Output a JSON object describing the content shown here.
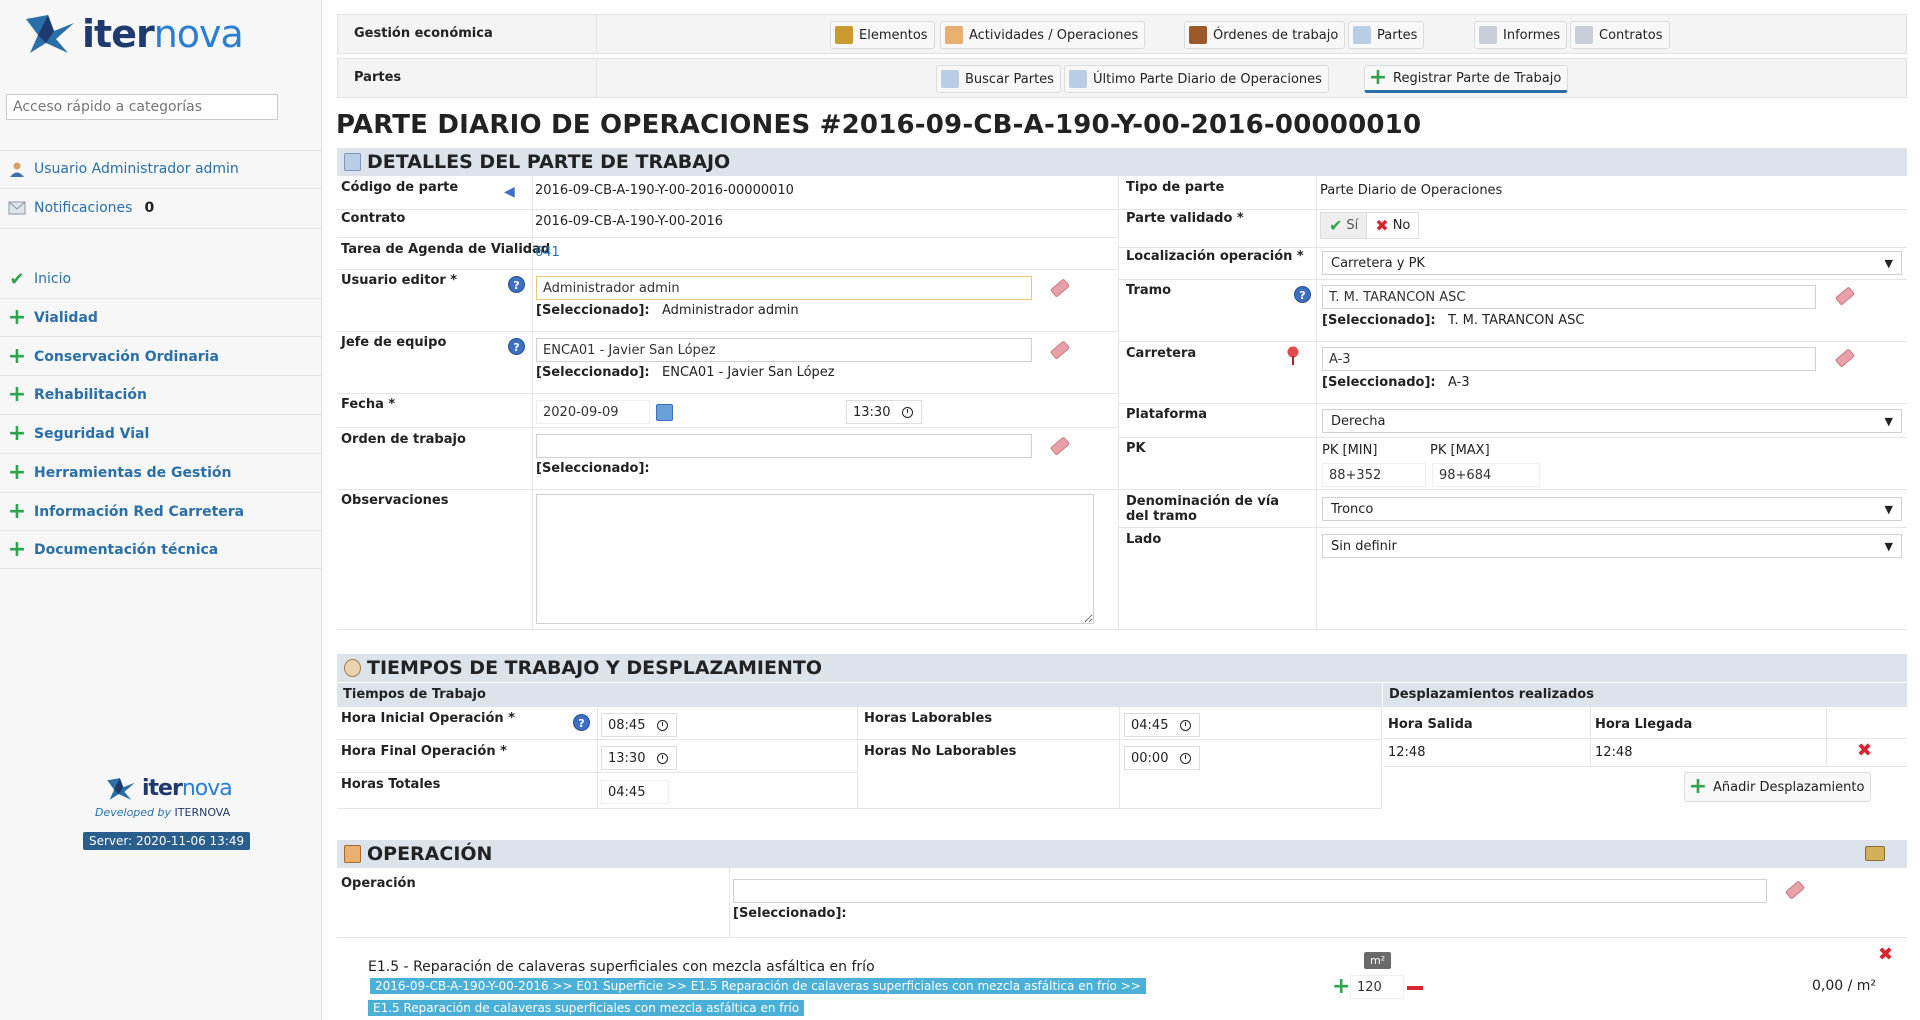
{
  "sidebar": {
    "logo_text_a": "iter",
    "logo_text_b": "nova",
    "search_placeholder": "Acceso rápido a categorías",
    "user": "Usuario Administrador admin",
    "notifications_label": "Notificaciones",
    "notifications_count": "0",
    "menu": [
      "Inicio",
      "Vialidad",
      "Conservación Ordinaria",
      "Rehabilitación",
      "Seguridad Vial",
      "Herramientas de Gestión",
      "Información Red Carretera",
      "Documentación técnica"
    ],
    "developed_by": "Developed by",
    "developer": "ITERNOVA",
    "server": "Server: 2020-11-06 13:49"
  },
  "nav": {
    "row1_label": "Gestión económica",
    "row2_label": "Partes",
    "row1_buttons": [
      "Elementos",
      "Actividades / Operaciones",
      "Órdenes de trabajo",
      "Partes",
      "Informes",
      "Contratos"
    ],
    "row2_buttons": [
      "Buscar Partes",
      "Último Parte Diario de Operaciones",
      "Registrar Parte de Trabajo"
    ]
  },
  "page_title": "PARTE DIARIO DE OPERACIONES #2016-09-CB-A-190-Y-00-2016-00000010",
  "details": {
    "heading": "DETALLES DEL PARTE DE TRABAJO",
    "codigo_label": "Código de parte",
    "codigo_value": "2016-09-CB-A-190-Y-00-2016-00000010",
    "contrato_label": "Contrato",
    "contrato_value": "2016-09-CB-A-190-Y-00-2016",
    "tarea_label": "Tarea de Agenda de Vialidad",
    "tarea_value": "641",
    "usuario_label": "Usuario editor *",
    "usuario_value": "Administrador admin",
    "usuario_selected": "Administrador admin",
    "jefe_label": "Jefe de equipo",
    "jefe_value": "ENCA01 - Javier San López",
    "jefe_selected": "ENCA01 - Javier San López",
    "fecha_label": "Fecha *",
    "fecha_value": "2020-09-09",
    "hora_value": "13:30",
    "orden_label": "Orden de trabajo",
    "orden_value": "",
    "observ_label": "Observaciones",
    "observ_value": "",
    "selected_prefix": "[Seleccionado]:",
    "tipo_label": "Tipo de parte",
    "tipo_value": "Parte Diario de Operaciones",
    "validado_label": "Parte validado *",
    "validado_yes": "Sí",
    "validado_no": "No",
    "localizacion_label": "Localización operación *",
    "localizacion_value": "Carretera y PK",
    "tramo_label": "Tramo",
    "tramo_value": "T. M. TARANCON ASC",
    "tramo_selected": "T. M. TARANCON ASC",
    "carretera_label": "Carretera",
    "carretera_value": "A-3",
    "carretera_selected": "A-3",
    "plataforma_label": "Plataforma",
    "plataforma_value": "Derecha",
    "pk_label": "PK",
    "pk_min_label": "PK [MIN]",
    "pk_max_label": "PK [MAX]",
    "pk_min_value": "88+352",
    "pk_max_value": "98+684",
    "denominacion_label": "Denominación de vía del tramo",
    "denominacion_value": "Tronco",
    "lado_label": "Lado",
    "lado_value": "Sin definir"
  },
  "tiempos": {
    "heading": "TIEMPOS DE TRABAJO Y DESPLAZAMIENTO",
    "sub_left": "Tiempos de Trabajo",
    "sub_right": "Desplazamientos realizados",
    "hora_inicial_label": "Hora Inicial Operación *",
    "hora_inicial_value": "08:45",
    "hora_final_label": "Hora Final Operación *",
    "hora_final_value": "13:30",
    "horas_totales_label": "Horas Totales",
    "horas_totales_value": "04:45",
    "horas_laborables_label": "Horas Laborables",
    "horas_laborables_value": "04:45",
    "horas_no_laborables_label": "Horas No Laborables",
    "horas_no_laborables_value": "00:00",
    "col_salida": "Hora Salida",
    "col_llegada": "Hora Llegada",
    "row_salida": "12:48",
    "row_llegada": "12:48",
    "add_btn": "Añadir Desplazamiento"
  },
  "operacion": {
    "heading": "OPERACIÓN",
    "label": "Operación",
    "value": "",
    "selected_prefix": "[Seleccionado]:",
    "item_title": "E1.5 - Reparación de calaveras superficiales con mezcla asfáltica en frío",
    "breadcrumb": "2016-09-CB-A-190-Y-00-2016 >> E01 Superficie >> E1.5 Reparación de calaveras superficiales con mezcla asfáltica en frío >>",
    "tag": "E1.5 Reparación de calaveras superficiales con mezcla asfáltica en frío",
    "unit": "m²",
    "qty": "120",
    "price": "0,00 / m²"
  },
  "colors": {
    "accent": "#2a6fa8",
    "section_bg": "#dde3ea",
    "add_green": "#2ea44f",
    "delete_red": "#d9232e",
    "tag_blue": "#4bb0d8"
  }
}
